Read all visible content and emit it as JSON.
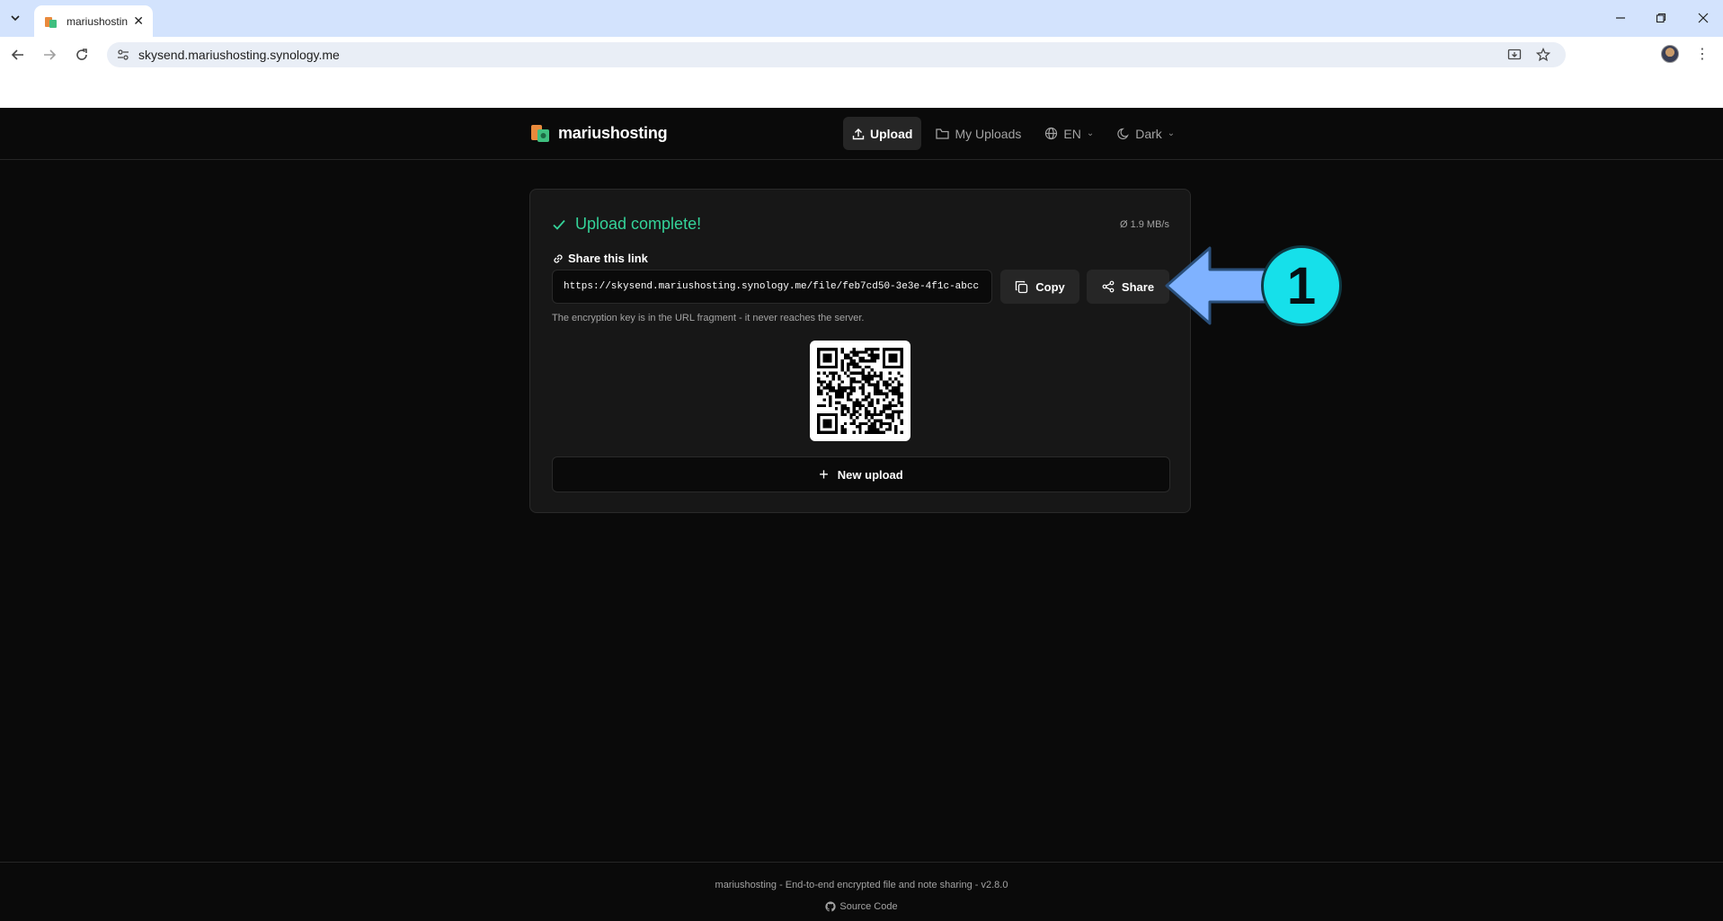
{
  "browser": {
    "tab_title": "mariushostin",
    "url": "skysend.mariushosting.synology.me"
  },
  "header": {
    "brand": "mariushosting",
    "nav": {
      "upload": "Upload",
      "my_uploads": "My Uploads",
      "language": "EN",
      "theme": "Dark"
    }
  },
  "card": {
    "status": "Upload complete!",
    "speed": "Ø 1.9 MB/s",
    "share_label": "Share this link",
    "link": "https://skysend.mariushosting.synology.me/file/feb7cd50-3e3e-4f1c-abcc",
    "copy_label": "Copy",
    "share_button": "Share",
    "hint": "The encryption key is in the URL fragment - it never reaches the server.",
    "new_upload": "New upload"
  },
  "annotation": {
    "number": "1"
  },
  "footer": {
    "tagline": "mariushosting - End-to-end encrypted file and note sharing - v2.8.0",
    "source": "Source Code"
  },
  "colors": {
    "accent_green": "#34d399",
    "annotation_arrow": "#7fb2ff",
    "annotation_badge": "#16e0ea"
  }
}
